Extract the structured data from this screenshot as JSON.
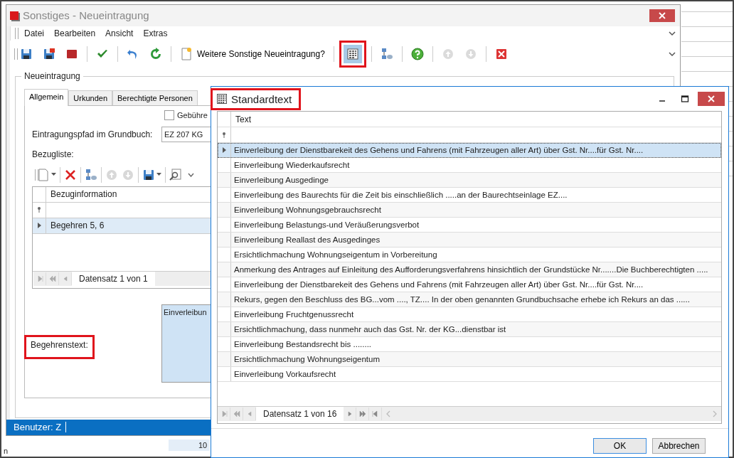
{
  "main_window": {
    "title": "Sonstiges - Neueintragung",
    "active": false,
    "menu": [
      "Datei",
      "Bearbeiten",
      "Ansicht",
      "Extras"
    ],
    "toolbar": [
      {
        "kind": "save",
        "disabled": false,
        "selected": false,
        "highlighted": false
      },
      {
        "kind": "save-delete",
        "disabled": false,
        "selected": false,
        "highlighted": false
      },
      {
        "kind": "stop",
        "disabled": false,
        "selected": false,
        "highlighted": false
      },
      {
        "kind": "check",
        "disabled": false,
        "selected": false,
        "highlighted": false
      },
      {
        "kind": "undo",
        "disabled": false,
        "selected": false,
        "highlighted": false
      },
      {
        "kind": "redo",
        "disabled": false,
        "selected": false,
        "highlighted": false
      },
      {
        "kind": "new-entry",
        "label": "Weitere Sonstige Neueintragung?",
        "disabled": false,
        "selected": false,
        "highlighted": false
      },
      {
        "kind": "standard-text",
        "disabled": false,
        "selected": true,
        "highlighted": true
      },
      {
        "kind": "network",
        "disabled": false,
        "selected": false,
        "highlighted": false
      },
      {
        "kind": "help",
        "disabled": false,
        "selected": false,
        "highlighted": false
      },
      {
        "kind": "up",
        "disabled": true,
        "selected": false,
        "highlighted": false
      },
      {
        "kind": "down",
        "disabled": true,
        "selected": false,
        "highlighted": false
      },
      {
        "kind": "close",
        "disabled": false,
        "selected": false,
        "highlighted": false
      }
    ],
    "group": {
      "title": "Neueintragung",
      "tabs": [
        {
          "label": "Allgemein",
          "selected": true
        },
        {
          "label": "Urkunden",
          "selected": false
        },
        {
          "label": "Berechtigte Personen",
          "selected": false
        }
      ],
      "fee_checkbox": {
        "label": "Gebühre",
        "checked": false
      },
      "path_label": "Eintragungspfad im Grundbuch:",
      "path_value": "EZ 207 KG",
      "list_label": "Bezugliste:",
      "list_toolbar": [
        {
          "kind": "new",
          "dropdown": true,
          "disabled": false
        },
        {
          "kind": "delete",
          "dropdown": false,
          "disabled": false
        },
        {
          "kind": "network",
          "dropdown": false,
          "disabled": false
        },
        {
          "kind": "up",
          "dropdown": false,
          "disabled": true
        },
        {
          "kind": "down",
          "dropdown": false,
          "disabled": true
        },
        {
          "kind": "print",
          "dropdown": true,
          "disabled": false
        },
        {
          "kind": "search",
          "dropdown": true,
          "disabled": false
        }
      ],
      "grid": {
        "columns": [
          "Bezuginformation"
        ],
        "rows": [
          {
            "cells": [
              "Begehren 5, 6"
            ],
            "selected": true
          }
        ],
        "navigator": "Datensatz 1 von 1"
      },
      "request_label": {
        "text": "Begehrenstext:",
        "highlighted": true
      },
      "request_text": "Einverleibun"
    },
    "status_bar": "Benutzer: Z"
  },
  "background_window": {
    "cell": "10",
    "edge_text": "n"
  },
  "dialog": {
    "title": "Standardtext",
    "highlighted": true,
    "columns": [
      "Text"
    ],
    "rows": [
      {
        "text": "Einverleibung der Dienstbarekeit des Gehens und Fahrens (mit Fahrzeugen aller Art) über Gst. Nr....für Gst. Nr....",
        "selected": true
      },
      {
        "text": "Einverleibung Wiederkaufsrecht",
        "selected": false
      },
      {
        "text": "Einverleibung Ausgedinge",
        "selected": false
      },
      {
        "text": "Einverleibung des Baurechts für die Zeit bis einschließlich .....an der Baurechtseinlage EZ....",
        "selected": false
      },
      {
        "text": "Einverleibung Wohnungsgebrauchsrecht",
        "selected": false
      },
      {
        "text": "Einverleibung Belastungs-und Veräußerungsverbot",
        "selected": false
      },
      {
        "text": "Einverleibung Reallast des Ausgedinges",
        "selected": false
      },
      {
        "text": "Ersichtlichmachung Wohnungseigentum in Vorbereitung",
        "selected": false
      },
      {
        "text": "Anmerkung des Antrages auf Einleitung des Aufforderungsverfahrens hinsichtlich der Grundstücke Nr.......Die Buchberechtigten .....",
        "selected": false
      },
      {
        "text": "Einverleibung der Dienstbarekeit des Gehens und Fahrens (mit Fahrzeugen aller Art) über Gst. Nr....für Gst. Nr....",
        "selected": false
      },
      {
        "text": "Rekurs, gegen den Beschluss des BG...vom ...., TZ.... In der oben genannten Grundbuchsache erhebe ich Rekurs an das ......",
        "selected": false
      },
      {
        "text": "Einverleibung Fruchtgenussrecht",
        "selected": false
      },
      {
        "text": "Ersichtlichmachung, dass nunmehr auch das Gst. Nr.  der KG...dienstbar ist",
        "selected": false
      },
      {
        "text": "Einverleibung Bestandsrecht bis ........",
        "selected": false
      },
      {
        "text": "Ersichtlichmachung Wohnungseigentum",
        "selected": false
      },
      {
        "text": "Einverleibung Vorkaufsrecht",
        "selected": false
      }
    ],
    "navigator": "Datensatz 1 von 16",
    "buttons": [
      {
        "label": "OK",
        "default": true
      },
      {
        "label": "Abbrechen",
        "default": false
      }
    ]
  }
}
